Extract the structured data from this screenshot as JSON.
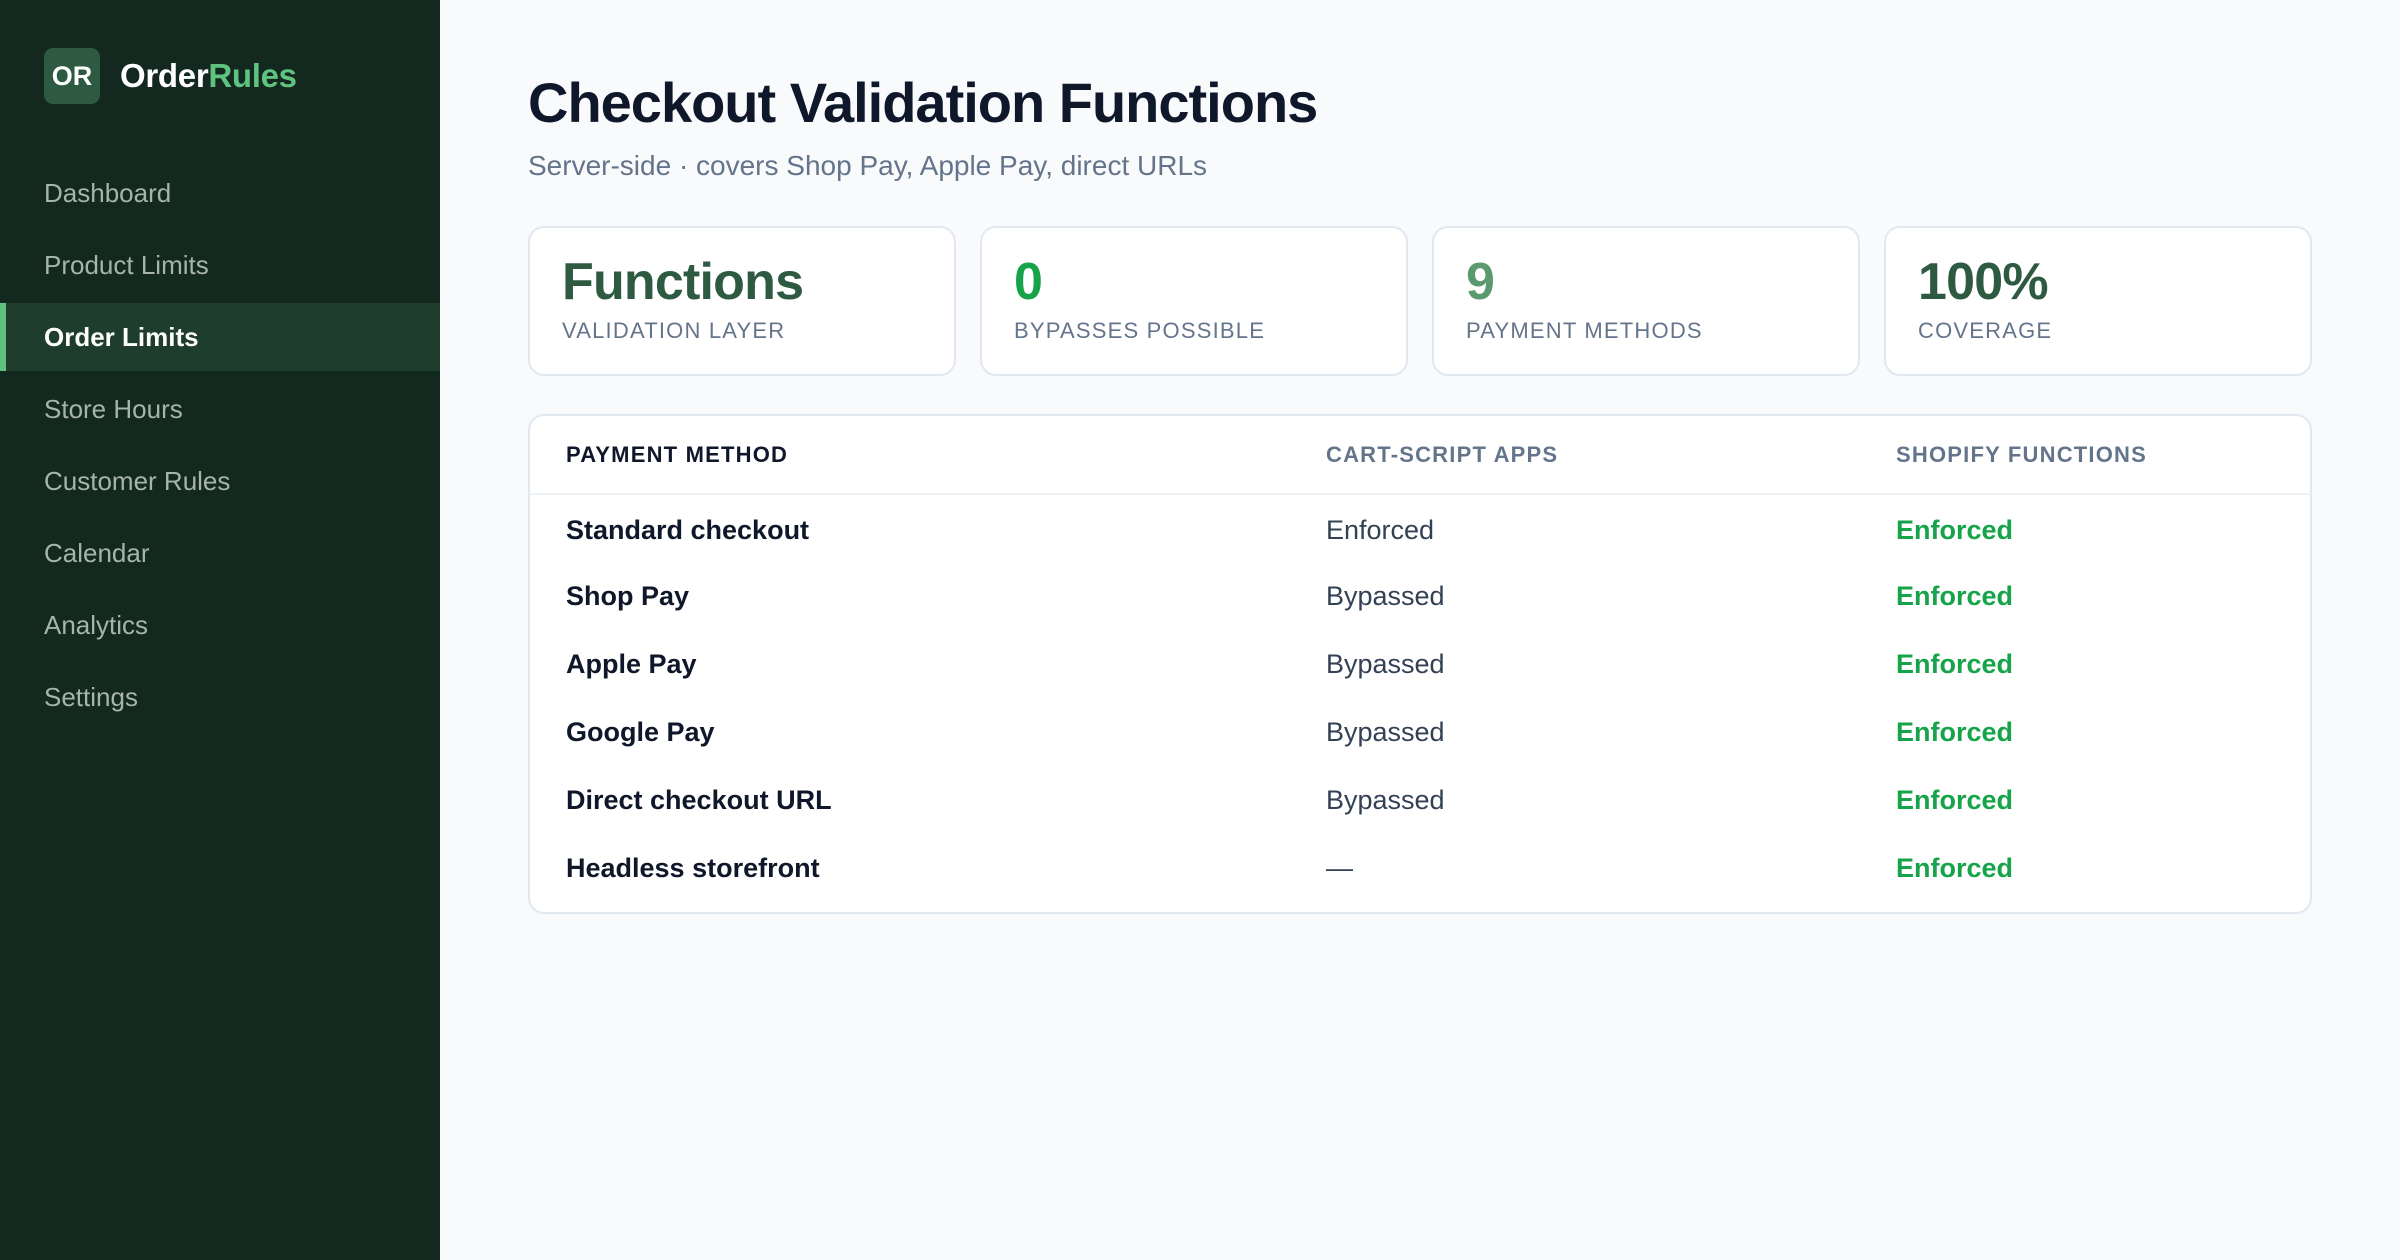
{
  "brand": {
    "badge": "OR",
    "name_part1": "Order",
    "name_part2": "Rules",
    "accent_color": "#5fc27e"
  },
  "nav": {
    "items": [
      {
        "label": "Dashboard",
        "active": false
      },
      {
        "label": "Product Limits",
        "active": false
      },
      {
        "label": "Order Limits",
        "active": true
      },
      {
        "label": "Store Hours",
        "active": false
      },
      {
        "label": "Customer Rules",
        "active": false
      },
      {
        "label": "Calendar",
        "active": false
      },
      {
        "label": "Analytics",
        "active": false
      },
      {
        "label": "Settings",
        "active": false
      }
    ]
  },
  "header": {
    "title": "Checkout Validation Functions",
    "subtitle": "Server-side · covers Shop Pay, Apple Pay, direct URLs"
  },
  "stats": [
    {
      "value": "Functions",
      "label": "Validation layer",
      "color": "#2d5a40"
    },
    {
      "value": "0",
      "label": "Bypasses possible",
      "color": "#16a34a"
    },
    {
      "value": "9",
      "label": "Payment methods",
      "color": "#5b9a6e"
    },
    {
      "value": "100%",
      "label": "Coverage",
      "color": "#2d5a40"
    }
  ],
  "table": {
    "headers": [
      "PAYMENT METHOD",
      "CART-SCRIPT APPS",
      "SHOPIFY FUNCTIONS"
    ],
    "rows": [
      {
        "method": "Standard checkout",
        "cart_script": "Enforced",
        "functions": "Enforced"
      },
      {
        "method": "Shop Pay",
        "cart_script": "Bypassed",
        "functions": "Enforced"
      },
      {
        "method": "Apple Pay",
        "cart_script": "Bypassed",
        "functions": "Enforced"
      },
      {
        "method": "Google Pay",
        "cart_script": "Bypassed",
        "functions": "Enforced"
      },
      {
        "method": "Direct checkout URL",
        "cart_script": "Bypassed",
        "functions": "Enforced"
      },
      {
        "method": "Headless storefront",
        "cart_script": "—",
        "functions": "Enforced"
      }
    ]
  },
  "colors": {
    "sidebar_bg": "#13281e",
    "enforced_green": "#16a34a"
  }
}
